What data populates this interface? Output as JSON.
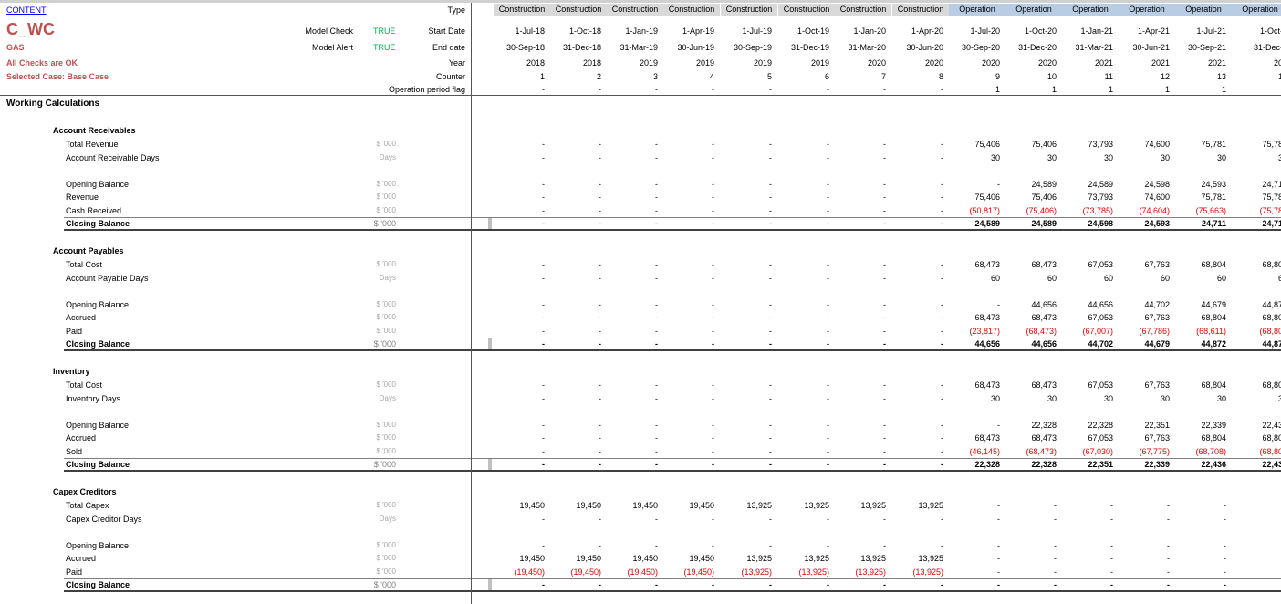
{
  "sheet": {
    "content_link": "CONTENT",
    "title": "C_WC",
    "subtitle": "GAS",
    "checks_status": "All Checks are OK",
    "selected_case": "Selected Case: Base Case",
    "model_check_label": "Model Check",
    "model_check_value": "TRUE",
    "model_alert_label": "Model Alert",
    "model_alert_value": "TRUE",
    "section_title": "Working Calculations"
  },
  "colors": {
    "construction_bg": "#d9d9d9",
    "operation_bg": "#b8cce4",
    "title_red": "#c0504d",
    "true_green": "#00b050",
    "negative_red": "#e60000",
    "link_blue": "#0000ff",
    "unit_grey": "#a6a6a6"
  },
  "header_labels": [
    "Type",
    "Start Date",
    "End date",
    "Year",
    "Counter",
    "Operation period flag"
  ],
  "columns": [
    {
      "type": "Construction",
      "start": "1-Jul-18",
      "end": "30-Sep-18",
      "year": "2018",
      "counter": "1",
      "flag": "-"
    },
    {
      "type": "Construction",
      "start": "1-Oct-18",
      "end": "31-Dec-18",
      "year": "2018",
      "counter": "2",
      "flag": "-"
    },
    {
      "type": "Construction",
      "start": "1-Jan-19",
      "end": "31-Mar-19",
      "year": "2019",
      "counter": "3",
      "flag": "-"
    },
    {
      "type": "Construction",
      "start": "1-Apr-19",
      "end": "30-Jun-19",
      "year": "2019",
      "counter": "4",
      "flag": "-"
    },
    {
      "type": "Construction",
      "start": "1-Jul-19",
      "end": "30-Sep-19",
      "year": "2019",
      "counter": "5",
      "flag": "-"
    },
    {
      "type": "Construction",
      "start": "1-Oct-19",
      "end": "31-Dec-19",
      "year": "2019",
      "counter": "6",
      "flag": "-"
    },
    {
      "type": "Construction",
      "start": "1-Jan-20",
      "end": "31-Mar-20",
      "year": "2020",
      "counter": "7",
      "flag": "-"
    },
    {
      "type": "Construction",
      "start": "1-Apr-20",
      "end": "30-Jun-20",
      "year": "2020",
      "counter": "8",
      "flag": "-"
    },
    {
      "type": "Operation",
      "start": "1-Jul-20",
      "end": "30-Sep-20",
      "year": "2020",
      "counter": "9",
      "flag": "1"
    },
    {
      "type": "Operation",
      "start": "1-Oct-20",
      "end": "31-Dec-20",
      "year": "2020",
      "counter": "10",
      "flag": "1"
    },
    {
      "type": "Operation",
      "start": "1-Jan-21",
      "end": "31-Mar-21",
      "year": "2021",
      "counter": "11",
      "flag": "1"
    },
    {
      "type": "Operation",
      "start": "1-Apr-21",
      "end": "30-Jun-21",
      "year": "2021",
      "counter": "12",
      "flag": "1"
    },
    {
      "type": "Operation",
      "start": "1-Jul-21",
      "end": "30-Sep-21",
      "year": "2021",
      "counter": "13",
      "flag": "1"
    },
    {
      "type": "Operation",
      "start": "1-Oct-",
      "end": "31-Dec-",
      "year": "20",
      "counter": "1",
      "flag": ""
    }
  ],
  "sections": [
    {
      "title": "Account Receivables",
      "rows": [
        {
          "label": "Total Revenue",
          "unit": "$ '000",
          "values": [
            "-",
            "-",
            "-",
            "-",
            "-",
            "-",
            "-",
            "-",
            "75,406",
            "75,406",
            "73,793",
            "74,600",
            "75,781",
            "75,78"
          ]
        },
        {
          "label": "Account Receivable Days",
          "unit": "Days",
          "values": [
            "-",
            "-",
            "-",
            "-",
            "-",
            "-",
            "-",
            "-",
            "30",
            "30",
            "30",
            "30",
            "30",
            "3"
          ]
        },
        {
          "label": "Opening Balance",
          "unit": "$ '000",
          "values": [
            "-",
            "-",
            "-",
            "-",
            "-",
            "-",
            "-",
            "-",
            "-",
            "24,589",
            "24,589",
            "24,598",
            "24,593",
            "24,71"
          ]
        },
        {
          "label": "Revenue",
          "unit": "$ '000",
          "values": [
            "-",
            "-",
            "-",
            "-",
            "-",
            "-",
            "-",
            "-",
            "75,406",
            "75,406",
            "73,793",
            "74,600",
            "75,781",
            "75,78"
          ]
        },
        {
          "label": "Cash Received",
          "unit": "$ '000",
          "values": [
            "-",
            "-",
            "-",
            "-",
            "-",
            "-",
            "-",
            "-",
            "(50,817)",
            "(75,406)",
            "(73,785)",
            "(74,604)",
            "(75,663)",
            "(75,78"
          ]
        },
        {
          "label": "Closing Balance",
          "unit": "$ '000",
          "values": [
            "-",
            "-",
            "-",
            "-",
            "-",
            "-",
            "-",
            "-",
            "24,589",
            "24,589",
            "24,598",
            "24,593",
            "24,711",
            "24,71"
          ]
        }
      ]
    },
    {
      "title": "Account Payables",
      "rows": [
        {
          "label": "Total Cost",
          "unit": "$ '000",
          "values": [
            "-",
            "-",
            "-",
            "-",
            "-",
            "-",
            "-",
            "-",
            "68,473",
            "68,473",
            "67,053",
            "67,763",
            "68,804",
            "68,80"
          ]
        },
        {
          "label": "Account Payable Days",
          "unit": "Days",
          "values": [
            "-",
            "-",
            "-",
            "-",
            "-",
            "-",
            "-",
            "-",
            "60",
            "60",
            "60",
            "60",
            "60",
            "6"
          ]
        },
        {
          "label": "Opening Balance",
          "unit": "$ '000",
          "values": [
            "-",
            "-",
            "-",
            "-",
            "-",
            "-",
            "-",
            "-",
            "-",
            "44,656",
            "44,656",
            "44,702",
            "44,679",
            "44,87"
          ]
        },
        {
          "label": "Accrued",
          "unit": "$ '000",
          "values": [
            "-",
            "-",
            "-",
            "-",
            "-",
            "-",
            "-",
            "-",
            "68,473",
            "68,473",
            "67,053",
            "67,763",
            "68,804",
            "68,80"
          ]
        },
        {
          "label": "Paid",
          "unit": "$ '000",
          "values": [
            "-",
            "-",
            "-",
            "-",
            "-",
            "-",
            "-",
            "-",
            "(23,817)",
            "(68,473)",
            "(67,007)",
            "(67,786)",
            "(68,611)",
            "(68,80"
          ]
        },
        {
          "label": "Closing Balance",
          "unit": "$ '000",
          "values": [
            "-",
            "-",
            "-",
            "-",
            "-",
            "-",
            "-",
            "-",
            "44,656",
            "44,656",
            "44,702",
            "44,679",
            "44,872",
            "44,87"
          ]
        }
      ]
    },
    {
      "title": "Inventory",
      "rows": [
        {
          "label": "Total Cost",
          "unit": "$ '000",
          "values": [
            "-",
            "-",
            "-",
            "-",
            "-",
            "-",
            "-",
            "-",
            "68,473",
            "68,473",
            "67,053",
            "67,763",
            "68,804",
            "68,80"
          ]
        },
        {
          "label": "Inventory Days",
          "unit": "Days",
          "values": [
            "-",
            "-",
            "-",
            "-",
            "-",
            "-",
            "-",
            "-",
            "30",
            "30",
            "30",
            "30",
            "30",
            "3"
          ]
        },
        {
          "label": "Opening Balance",
          "unit": "$ '000",
          "values": [
            "-",
            "-",
            "-",
            "-",
            "-",
            "-",
            "-",
            "-",
            "-",
            "22,328",
            "22,328",
            "22,351",
            "22,339",
            "22,43"
          ]
        },
        {
          "label": "Accrued",
          "unit": "$ '000",
          "values": [
            "-",
            "-",
            "-",
            "-",
            "-",
            "-",
            "-",
            "-",
            "68,473",
            "68,473",
            "67,053",
            "67,763",
            "68,804",
            "68,80"
          ]
        },
        {
          "label": "Sold",
          "unit": "$ '000",
          "values": [
            "-",
            "-",
            "-",
            "-",
            "-",
            "-",
            "-",
            "-",
            "(46,145)",
            "(68,473)",
            "(67,030)",
            "(67,775)",
            "(68,708)",
            "(68,80"
          ]
        },
        {
          "label": "Closing Balance",
          "unit": "$ '000",
          "values": [
            "-",
            "-",
            "-",
            "-",
            "-",
            "-",
            "-",
            "-",
            "22,328",
            "22,328",
            "22,351",
            "22,339",
            "22,436",
            "22,43"
          ]
        }
      ]
    },
    {
      "title": "Capex Creditors",
      "rows": [
        {
          "label": "Total Capex",
          "unit": "$ '000",
          "values": [
            "19,450",
            "19,450",
            "19,450",
            "19,450",
            "13,925",
            "13,925",
            "13,925",
            "13,925",
            "-",
            "-",
            "-",
            "-",
            "-",
            ""
          ]
        },
        {
          "label": "Capex Creditor Days",
          "unit": "Days",
          "values": [
            "-",
            "-",
            "-",
            "-",
            "-",
            "-",
            "-",
            "-",
            "-",
            "-",
            "-",
            "-",
            "-",
            ""
          ]
        },
        {
          "label": "Opening Balance",
          "unit": "$ '000",
          "values": [
            "-",
            "-",
            "-",
            "-",
            "-",
            "-",
            "-",
            "-",
            "-",
            "-",
            "-",
            "-",
            "-",
            ""
          ]
        },
        {
          "label": "Accrued",
          "unit": "$ '000",
          "values": [
            "19,450",
            "19,450",
            "19,450",
            "19,450",
            "13,925",
            "13,925",
            "13,925",
            "13,925",
            "-",
            "-",
            "-",
            "-",
            "-",
            ""
          ]
        },
        {
          "label": "Paid",
          "unit": "$ '000",
          "values": [
            "(19,450)",
            "(19,450)",
            "(19,450)",
            "(19,450)",
            "(13,925)",
            "(13,925)",
            "(13,925)",
            "(13,925)",
            "-",
            "-",
            "-",
            "-",
            "-",
            ""
          ]
        },
        {
          "label": "Closing Balance",
          "unit": "$ '000",
          "values": [
            "-",
            "-",
            "-",
            "-",
            "-",
            "-",
            "-",
            "-",
            "-",
            "-",
            "-",
            "-",
            "-",
            ""
          ]
        }
      ]
    }
  ]
}
